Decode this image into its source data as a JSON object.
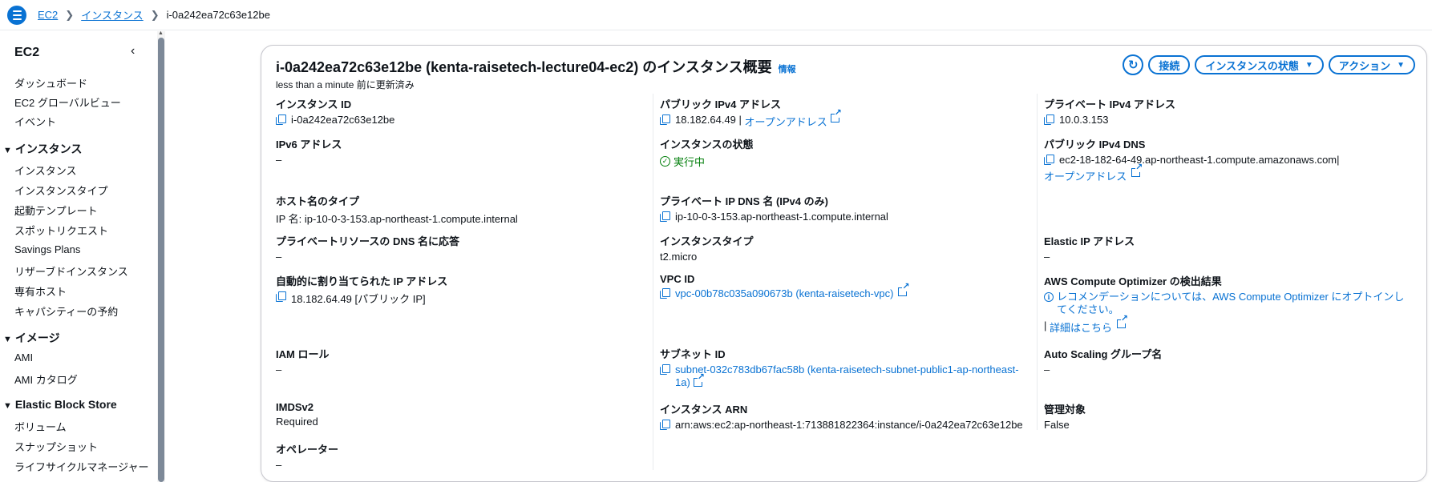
{
  "breadcrumb": {
    "items": [
      "EC2",
      "インスタンス"
    ],
    "current": "i-0a242ea72c63e12be"
  },
  "sidebar": {
    "title": "EC2",
    "top_items": [
      "ダッシュボード",
      "EC2 グローバルビュー",
      "イベント"
    ],
    "sections": [
      {
        "title": "インスタンス",
        "items": [
          "インスタンス",
          "インスタンスタイプ",
          "起動テンプレート",
          "スポットリクエスト",
          "Savings Plans",
          "リザーブドインスタンス",
          "専有ホスト",
          "キャパシティーの予約"
        ]
      },
      {
        "title": "イメージ",
        "items": [
          "AMI",
          "AMI カタログ"
        ]
      },
      {
        "title": "Elastic Block Store",
        "items": [
          "ボリューム",
          "スナップショット",
          "ライフサイクルマネージャー"
        ]
      }
    ]
  },
  "panel": {
    "title": "i-0a242ea72c63e12be (kenta-raisetech-lecture04-ec2) のインスタンス概要",
    "info": "情報",
    "subtitle": "less than a minute 前に更新済み",
    "buttons": {
      "connect": "接続",
      "instance_state": "インスタンスの状態",
      "actions": "アクション"
    }
  },
  "fields": {
    "instance_id": {
      "label": "インスタンス ID",
      "value": "i-0a242ea72c63e12be"
    },
    "ipv6": {
      "label": "IPv6 アドレス",
      "value": "–"
    },
    "hostname_type": {
      "label": "ホスト名のタイプ",
      "value": "IP 名: ip-10-0-3-153.ap-northeast-1.compute.internal"
    },
    "private_dns_answer": {
      "label": "プライベートリソースの DNS 名に応答",
      "value": "–"
    },
    "auto_ip": {
      "label": "自動的に割り当てられた IP アドレス",
      "value": "18.182.64.49 [パブリック IP]"
    },
    "iam_role": {
      "label": "IAM ロール",
      "value": "–"
    },
    "imdsv2": {
      "label": "IMDSv2",
      "value": "Required"
    },
    "operator": {
      "label": "オペレーター",
      "value": "–"
    },
    "public_ipv4": {
      "label": "パブリック IPv4 アドレス",
      "value": "18.182.64.49",
      "link": "オープンアドレス"
    },
    "instance_state": {
      "label": "インスタンスの状態",
      "value": "実行中"
    },
    "private_ip_dns": {
      "label": "プライベート IP DNS 名 (IPv4 のみ)",
      "value": "ip-10-0-3-153.ap-northeast-1.compute.internal"
    },
    "instance_type": {
      "label": "インスタンスタイプ",
      "value": "t2.micro"
    },
    "vpc_id": {
      "label": "VPC ID",
      "value": "vpc-00b78c035a090673b (kenta-raisetech-vpc)"
    },
    "subnet_id": {
      "label": "サブネット ID",
      "value": "subnet-032c783db67fac58b (kenta-raisetech-subnet-public1-ap-northeast-1a)"
    },
    "instance_arn": {
      "label": "インスタンス ARN",
      "value": "arn:aws:ec2:ap-northeast-1:713881822364:instance/i-0a242ea72c63e12be"
    },
    "private_ipv4": {
      "label": "プライベート IPv4 アドレス",
      "value": "10.0.3.153"
    },
    "public_dns": {
      "label": "パブリック IPv4 DNS",
      "value": "ec2-18-182-64-49.ap-northeast-1.compute.amazonaws.com",
      "link": "オープンアドレス"
    },
    "elastic_ip": {
      "label": "Elastic IP アドレス",
      "value": "–"
    },
    "compute_optimizer": {
      "label": "AWS Compute Optimizer の検出結果",
      "value": "レコメンデーションについては、AWS Compute Optimizer にオプトインしてください。",
      "link": "詳細はこちら"
    },
    "asg_name": {
      "label": "Auto Scaling グループ名",
      "value": "–"
    },
    "managed": {
      "label": "管理対象",
      "value": "False"
    }
  }
}
